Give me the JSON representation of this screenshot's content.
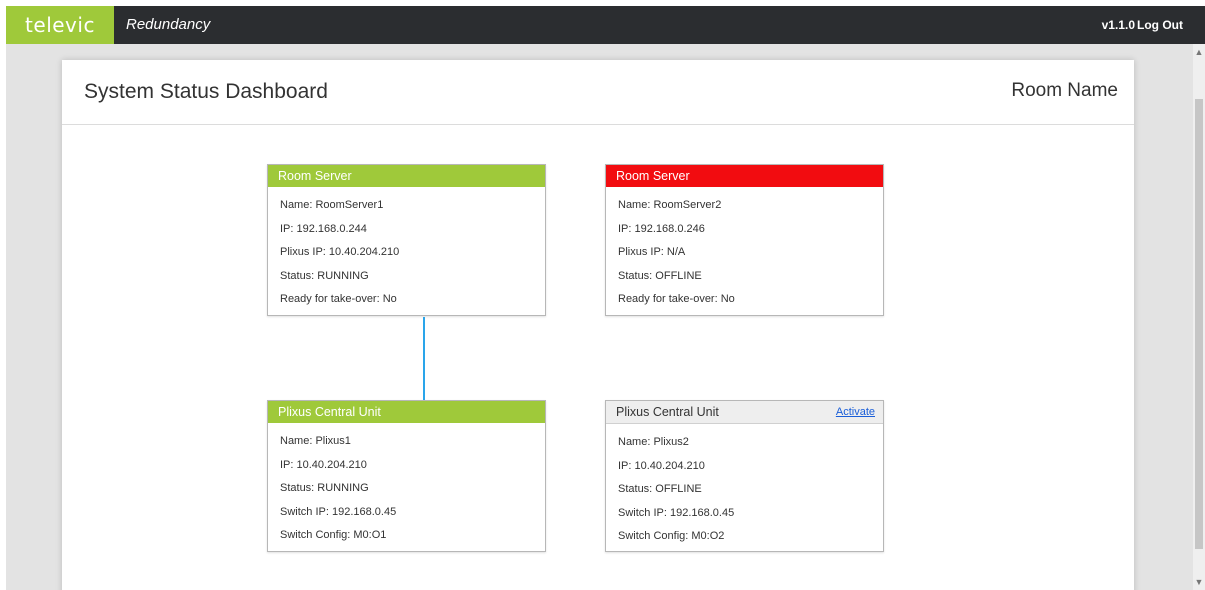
{
  "topbar": {
    "logo": "televic",
    "app_title": "Redundancy",
    "version": "v1.1.0",
    "logout_label": "Log Out"
  },
  "panel": {
    "title": "System Status Dashboard",
    "room_name": "Room Name"
  },
  "cards": {
    "server1": {
      "header": "Room Server",
      "status_color": "#9fc93a",
      "rows": [
        "Name: RoomServer1",
        "IP: 192.168.0.244",
        "Plixus IP: 10.40.204.210",
        "Status: RUNNING",
        "Ready for take-over: No"
      ]
    },
    "server2": {
      "header": "Room Server",
      "status_color": "#f20c10",
      "rows": [
        "Name: RoomServer2",
        "IP: 192.168.0.246",
        "Plixus IP: N/A",
        "Status: OFFLINE",
        "Ready for take-over: No"
      ]
    },
    "plixus1": {
      "header": "Plixus Central Unit",
      "status_color": "#9fc93a",
      "rows": [
        "Name: Plixus1",
        "IP: 10.40.204.210",
        "Status: RUNNING",
        "Switch IP: 192.168.0.45",
        "Switch Config: M0:O1"
      ]
    },
    "plixus2": {
      "header": "Plixus Central Unit",
      "status_color": "#eeeeee",
      "activate_label": "Activate",
      "rows": [
        "Name: Plixus2",
        "IP: 10.40.204.210",
        "Status: OFFLINE",
        "Switch IP: 192.168.0.45",
        "Switch Config: M0:O2"
      ]
    }
  },
  "colors": {
    "accent_green": "#9fc93a",
    "offline_red": "#f20c10",
    "connector_blue": "#2aa5ea",
    "topbar": "#2b2d30"
  }
}
